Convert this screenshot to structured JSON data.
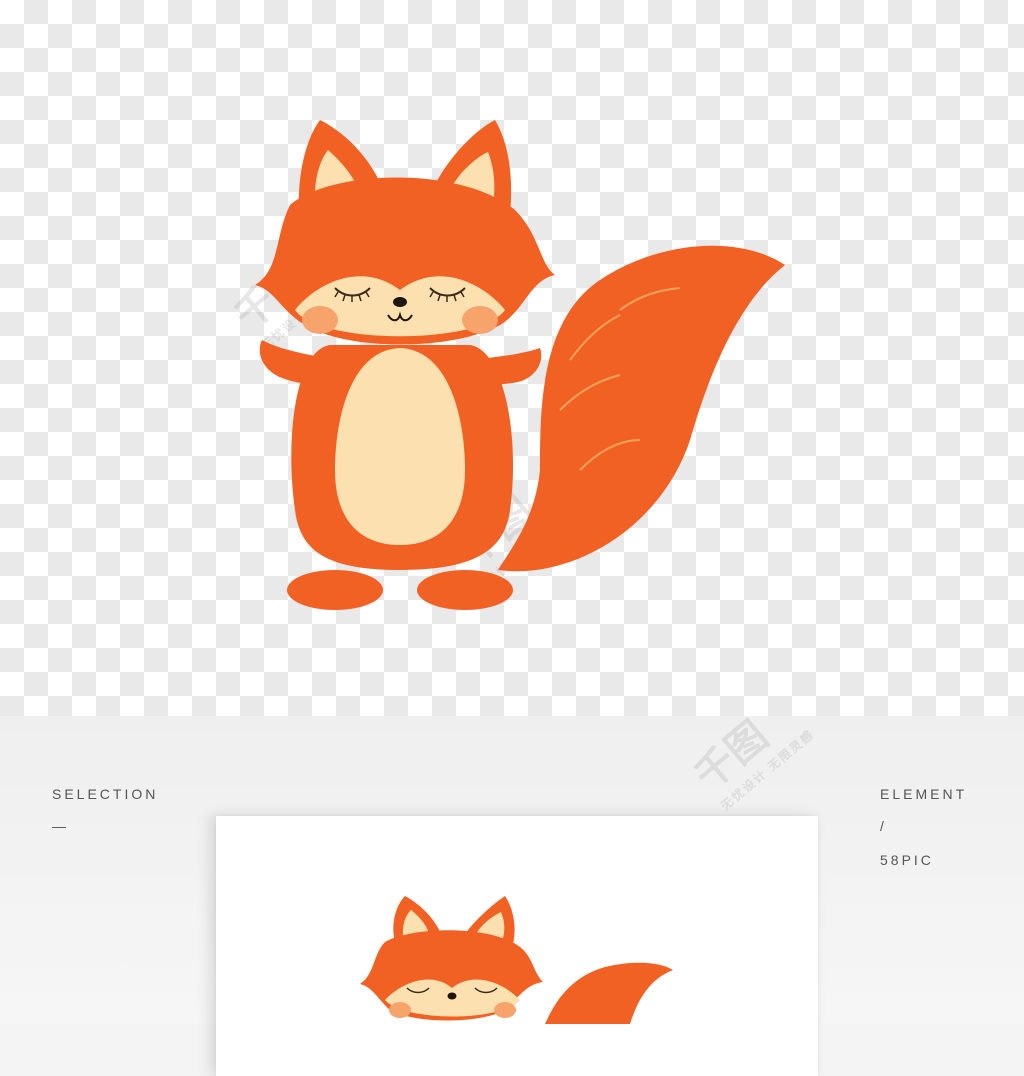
{
  "labels": {
    "left_top": "SELECTION",
    "left_dash": "—",
    "right_top": "ELEMENT",
    "right_slash": "/",
    "right_bottom": "58PIC"
  },
  "watermark": {
    "brand": "千图",
    "tagline": "无忧设计 无限灵感"
  },
  "colors": {
    "fur": "#f26124",
    "belly": "#fde0b0",
    "cheek": "#f6a46c"
  }
}
